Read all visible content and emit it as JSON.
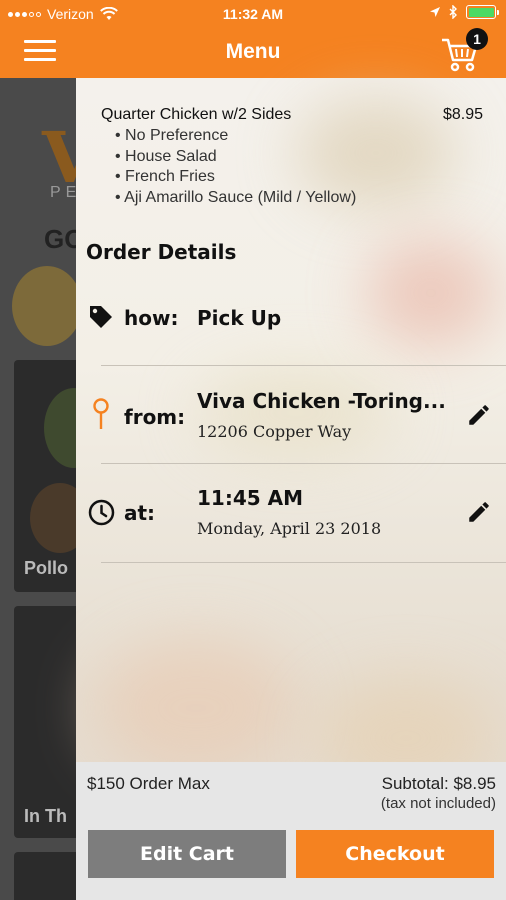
{
  "status": {
    "carrier": "Verizon",
    "time": "11:32 AM"
  },
  "nav": {
    "title": "Menu",
    "cart_count": "1"
  },
  "background_page": {
    "partial_logo": "V",
    "partial_logo_sub": "PE",
    "partial_heading": "GO",
    "partial_card_1": "Pollo",
    "partial_card_2": "In Th"
  },
  "cart": {
    "item_name": "Quarter Chicken w/2 Sides",
    "item_price": "$8.95",
    "modifiers": [
      "No Preference",
      "House Salad",
      "French Fries",
      "Aji Amarillo Sauce (Mild / Yellow)"
    ]
  },
  "order_details": {
    "heading": "Order Details",
    "how_label": "how:",
    "how_value": "Pick Up",
    "from_label": "from:",
    "from_value": "Viva Chicken -Toring...",
    "from_address": "12206 Copper Way",
    "at_label": "at:",
    "at_time": "11:45 AM",
    "at_date": "Monday, April 23 2018"
  },
  "footer": {
    "order_max": "$150 Order Max",
    "subtotal": "Subtotal: $8.95",
    "tax_note": "(tax not included)",
    "edit_cart_label": "Edit Cart",
    "checkout_label": "Checkout"
  },
  "colors": {
    "brand_orange": "#f58220",
    "edit_button_gray": "#7d7d7d",
    "battery_green": "#4cd964"
  },
  "icons": {
    "menu": "hamburger-icon",
    "cart": "cart-icon",
    "how": "tag-icon",
    "from": "location-pin-icon",
    "at": "clock-icon",
    "edit": "pencil-icon"
  }
}
